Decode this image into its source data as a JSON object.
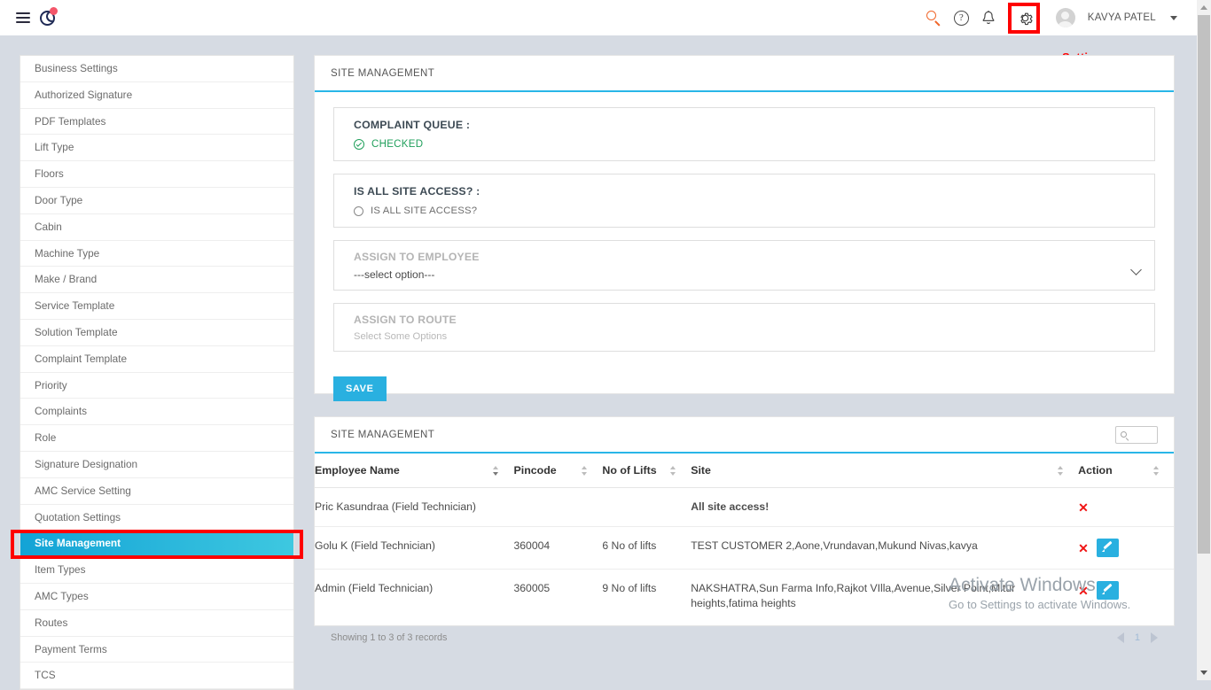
{
  "header": {
    "logo_icon": "globe-logo-icon",
    "menu_icon": "hamburger-menu-icon",
    "search_icon": "search-icon",
    "help_icon": "help-circle-icon",
    "help_glyph": "?",
    "bell_icon": "notification-bell-icon",
    "gear_icon": "settings-gear-icon",
    "avatar_icon": "user-avatar-icon",
    "user_name": "KAVYA PATEL",
    "settings_tooltip": "Settings",
    "highlight_color": "#fe0000"
  },
  "sidebar": {
    "items": [
      {
        "label": "Business Settings",
        "active": false
      },
      {
        "label": "Authorized Signature",
        "active": false
      },
      {
        "label": "PDF Templates",
        "active": false
      },
      {
        "label": "Lift Type",
        "active": false
      },
      {
        "label": "Floors",
        "active": false
      },
      {
        "label": "Door Type",
        "active": false
      },
      {
        "label": "Cabin",
        "active": false
      },
      {
        "label": "Machine Type",
        "active": false
      },
      {
        "label": "Make / Brand",
        "active": false
      },
      {
        "label": "Service Template",
        "active": false
      },
      {
        "label": "Solution Template",
        "active": false
      },
      {
        "label": "Complaint Template",
        "active": false
      },
      {
        "label": "Priority",
        "active": false
      },
      {
        "label": "Complaints",
        "active": false
      },
      {
        "label": "Role",
        "active": false
      },
      {
        "label": "Signature Designation",
        "active": false
      },
      {
        "label": "AMC Service Setting",
        "active": false
      },
      {
        "label": "Quotation Settings",
        "active": false
      },
      {
        "label": "Site Management",
        "active": true
      },
      {
        "label": "Item Types",
        "active": false
      },
      {
        "label": "AMC Types",
        "active": false
      },
      {
        "label": "Routes",
        "active": false
      },
      {
        "label": "Payment Terms",
        "active": false
      },
      {
        "label": "TCS",
        "active": false
      }
    ],
    "active_accent": "#13a3d6"
  },
  "form_panel": {
    "title": "SITE MANAGEMENT",
    "complaint_queue": {
      "label": "COMPLAINT QUEUE :",
      "option_label": "CHECKED",
      "checked": true,
      "checked_color": "#21a05c"
    },
    "all_site_access": {
      "label": "IS ALL SITE ACCESS? :",
      "option_label": "IS ALL SITE ACCESS?",
      "checked": false
    },
    "assign_to_employee": {
      "label": "ASSIGN TO EMPLOYEE",
      "value": "---select option---",
      "chevron_icon": "chevron-down-icon"
    },
    "assign_to_route": {
      "label": "ASSIGN TO ROUTE",
      "placeholder": "Select Some Options"
    },
    "save_label": "SAVE",
    "accent_color": "#29b0e8"
  },
  "table_panel": {
    "title": "SITE MANAGEMENT",
    "search_placeholder": "",
    "search_value": "",
    "search_icon": "search-icon",
    "columns": [
      {
        "label": "Employee Name",
        "sort": "desc"
      },
      {
        "label": "Pincode",
        "sort": "none"
      },
      {
        "label": "No of Lifts",
        "sort": "none"
      },
      {
        "label": "Site",
        "sort": "none"
      },
      {
        "label": "Action",
        "sort": "none"
      }
    ],
    "rows": [
      {
        "employee_name": "Pric Kasundraa (Field Technician)",
        "pincode": "",
        "no_of_lifts": "",
        "site": "All site access!",
        "site_is_all_access": true,
        "has_edit": false
      },
      {
        "employee_name": "Golu K (Field Technician)",
        "pincode": "360004",
        "no_of_lifts": "6 No of lifts",
        "site": "TEST CUSTOMER 2,Aone,Vrundavan,Mukund Nivas,kavya",
        "site_is_all_access": false,
        "has_edit": true
      },
      {
        "employee_name": "Admin (Field Technician)",
        "pincode": "360005",
        "no_of_lifts": "9 No of lifts",
        "site": "NAKSHATRA,Sun Farma Info,Rajkot VIlla,Avenue,Silver Point,Mitur heights,fatima heights",
        "site_is_all_access": false,
        "has_edit": true
      }
    ],
    "showing_text": "Showing 1 to 3 of 3 records",
    "pagination": {
      "prev_icon": "chevron-left-icon",
      "page": "1",
      "next_icon": "chevron-right-icon"
    },
    "delete_icon": "delete-cross-icon",
    "edit_icon": "edit-pencil-icon"
  },
  "watermark": {
    "line1": "Activate Windows",
    "line2": "Go to Settings to activate Windows."
  }
}
